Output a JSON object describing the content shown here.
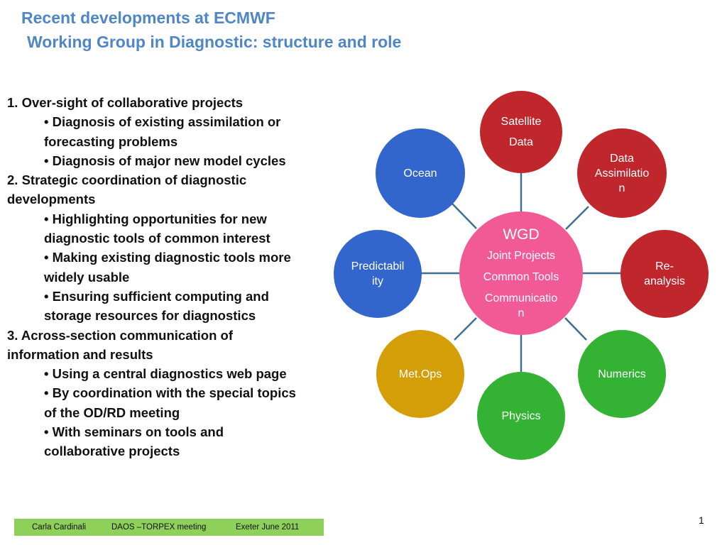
{
  "title": {
    "line1": "Recent developments at ECMWF",
    "line2": "Working  Group in Diagnostic: structure and role"
  },
  "body": {
    "item1": "1. Over-sight of collaborative projects",
    "item1_b1": "• Diagnosis of existing assimilation or",
    "item1_b1c": "forecasting problems",
    "item1_b2": "• Diagnosis of major new model cycles",
    "item2": "2. Strategic coordination of diagnostic",
    "item2c": "developments",
    "item2_b1": "• Highlighting opportunities for new",
    "item2_b1c": "diagnostic tools of common interest",
    "item2_b2": "• Making existing diagnostic tools more",
    "item2_b2c": "widely usable",
    "item2_b3": "• Ensuring sufficient computing and",
    "item2_b3c": "storage resources for diagnostics",
    "item3": "3. Across-section communication of",
    "item3c": "information and results",
    "item3_b1": "• Using a central diagnostics web page",
    "item3_b2": "• By coordination with the special topics",
    "item3_b2c": "of the OD/RD meeting",
    "item3_b3": "• With seminars on tools and",
    "item3_b3c": "collaborative projects"
  },
  "diagram": {
    "center": {
      "title": "WGD",
      "line1": "Joint Projects",
      "line2": "Common Tools",
      "line3a": "Communicatio",
      "line3b": "n"
    },
    "satellite": {
      "line1": "Satellite",
      "line2": "Data"
    },
    "data_assim": {
      "line1": "Data",
      "line2": "Assimilatio",
      "line3": "n"
    },
    "reanalysis": {
      "line1": "Re-",
      "line2": "analysis"
    },
    "numerics": "Numerics",
    "physics": "Physics",
    "metops": "Met.Ops",
    "predictability": {
      "line1": "Predictabil",
      "line2": "ity"
    },
    "ocean": "Ocean"
  },
  "colors": {
    "title": "#4f86c6",
    "red": "#c0272d",
    "blue": "#3366cc",
    "green": "#33b233",
    "gold": "#d49e08",
    "pink": "#f25a96",
    "connector": "#3f6f8f",
    "footer": "#8fd05a"
  },
  "footer": {
    "author": "Carla Cardinali",
    "meeting": "DAOS –TORPEX meeting",
    "place_date": "Exeter June 2011"
  },
  "page_number": "1"
}
